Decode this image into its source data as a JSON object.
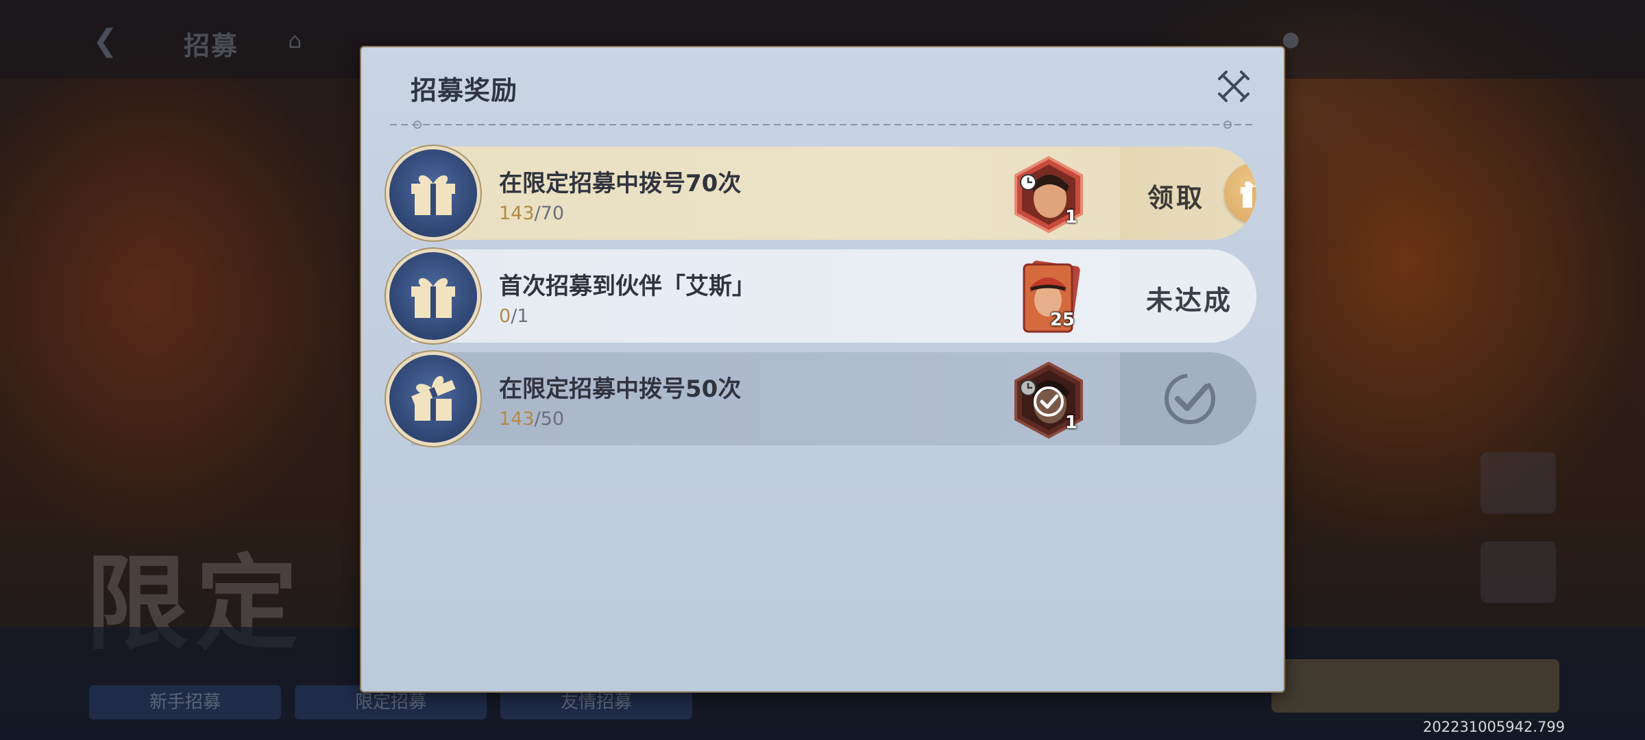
{
  "background": {
    "title": "招募",
    "big_text": "限定",
    "bottom_tabs": [
      "新手招募",
      "限定招募",
      "友情招募"
    ]
  },
  "modal": {
    "title": "招募奖励",
    "close_icon": "crossed-swords-close-icon"
  },
  "rewards": [
    {
      "title": "在限定招募中拨号70次",
      "progress_current": "143",
      "progress_total": "/70",
      "reward_icon": "ace-portrait-timed-icon",
      "reward_count": "1",
      "status": "claimable",
      "action_label": "领取"
    },
    {
      "title": "首次招募到伙伴「艾斯」",
      "progress_current": "0",
      "progress_total": "/1",
      "reward_icon": "ace-fragment-card-icon",
      "reward_count": "25",
      "status": "incomplete",
      "action_label": "未达成"
    },
    {
      "title": "在限定招募中拨号50次",
      "progress_current": "143",
      "progress_total": "/50",
      "reward_icon": "ace-portrait-claimed-icon",
      "reward_count": "1",
      "status": "claimed",
      "action_label": ""
    }
  ],
  "timestamp": "202231005942.799",
  "colors": {
    "modal_bg": "#c6d2e1",
    "claimable_row": "#ece2c6",
    "gift_circle": "#34497a",
    "progress_accent": "#b28a45",
    "claim_gift": "#e2b46e"
  }
}
